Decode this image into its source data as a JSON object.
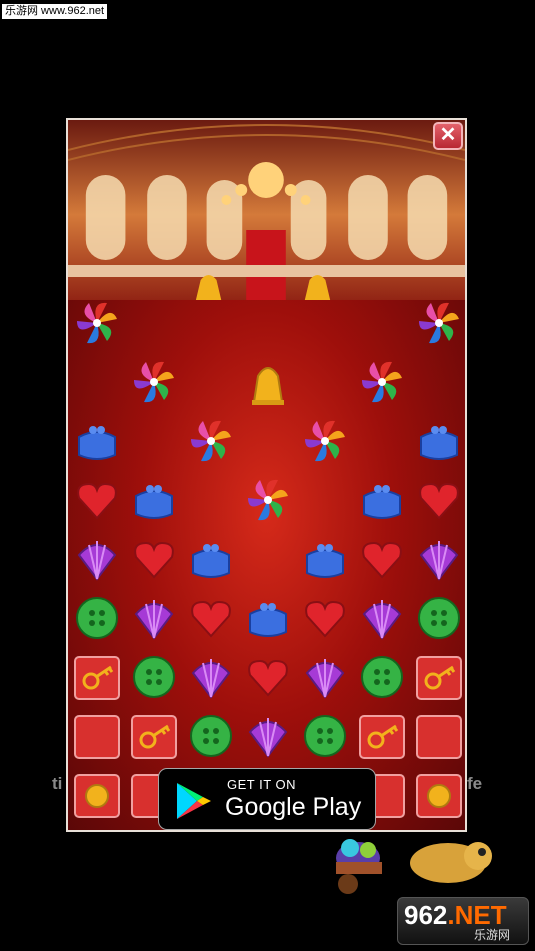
{
  "watermark_top": "乐游网 www.962.net",
  "close_label": "✕",
  "store_badge": {
    "line1": "GET IT ON",
    "line2": "Google Play"
  },
  "side_left": "ti",
  "side_right": "fe",
  "watermark_bottom": {
    "num_a": "962",
    "num_b": ".NET",
    "sub": "乐游网"
  },
  "board": {
    "rows": [
      [
        "pinwheel",
        "",
        "",
        "",
        "",
        "",
        "pinwheel"
      ],
      [
        "",
        "pinwheel",
        "",
        "bell",
        "",
        "pinwheel",
        ""
      ],
      [
        "purse",
        "",
        "pinwheel",
        "",
        "pinwheel",
        "",
        "purse"
      ],
      [
        "heart",
        "purse",
        "",
        "pinwheel",
        "",
        "purse",
        "heart"
      ],
      [
        "shell",
        "heart",
        "purse",
        "",
        "purse",
        "heart",
        "shell"
      ],
      [
        "button",
        "shell",
        "heart",
        "purse",
        "heart",
        "shell",
        "button"
      ],
      [
        "chest-key",
        "button",
        "shell",
        "heart",
        "shell",
        "button",
        "chest-key"
      ],
      [
        "chest",
        "chest-key",
        "button",
        "shell",
        "button",
        "chest-key",
        "chest"
      ],
      [
        "chest-coin",
        "chest",
        "",
        "",
        "",
        "chest",
        "chest-coin"
      ]
    ]
  },
  "colors": {
    "accent_red": "#c8141b",
    "gold": "#f2b21c"
  }
}
